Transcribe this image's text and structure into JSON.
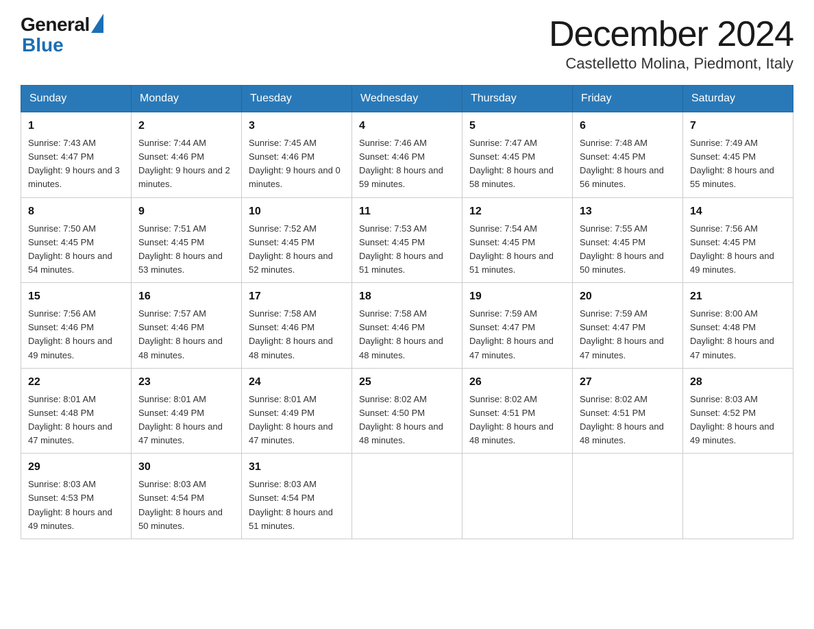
{
  "header": {
    "logo_general": "General",
    "logo_blue": "Blue",
    "month_title": "December 2024",
    "location": "Castelletto Molina, Piedmont, Italy"
  },
  "days_of_week": [
    "Sunday",
    "Monday",
    "Tuesday",
    "Wednesday",
    "Thursday",
    "Friday",
    "Saturday"
  ],
  "weeks": [
    [
      {
        "day": "1",
        "sunrise": "7:43 AM",
        "sunset": "4:47 PM",
        "daylight": "9 hours and 3 minutes."
      },
      {
        "day": "2",
        "sunrise": "7:44 AM",
        "sunset": "4:46 PM",
        "daylight": "9 hours and 2 minutes."
      },
      {
        "day": "3",
        "sunrise": "7:45 AM",
        "sunset": "4:46 PM",
        "daylight": "9 hours and 0 minutes."
      },
      {
        "day": "4",
        "sunrise": "7:46 AM",
        "sunset": "4:46 PM",
        "daylight": "8 hours and 59 minutes."
      },
      {
        "day": "5",
        "sunrise": "7:47 AM",
        "sunset": "4:45 PM",
        "daylight": "8 hours and 58 minutes."
      },
      {
        "day": "6",
        "sunrise": "7:48 AM",
        "sunset": "4:45 PM",
        "daylight": "8 hours and 56 minutes."
      },
      {
        "day": "7",
        "sunrise": "7:49 AM",
        "sunset": "4:45 PM",
        "daylight": "8 hours and 55 minutes."
      }
    ],
    [
      {
        "day": "8",
        "sunrise": "7:50 AM",
        "sunset": "4:45 PM",
        "daylight": "8 hours and 54 minutes."
      },
      {
        "day": "9",
        "sunrise": "7:51 AM",
        "sunset": "4:45 PM",
        "daylight": "8 hours and 53 minutes."
      },
      {
        "day": "10",
        "sunrise": "7:52 AM",
        "sunset": "4:45 PM",
        "daylight": "8 hours and 52 minutes."
      },
      {
        "day": "11",
        "sunrise": "7:53 AM",
        "sunset": "4:45 PM",
        "daylight": "8 hours and 51 minutes."
      },
      {
        "day": "12",
        "sunrise": "7:54 AM",
        "sunset": "4:45 PM",
        "daylight": "8 hours and 51 minutes."
      },
      {
        "day": "13",
        "sunrise": "7:55 AM",
        "sunset": "4:45 PM",
        "daylight": "8 hours and 50 minutes."
      },
      {
        "day": "14",
        "sunrise": "7:56 AM",
        "sunset": "4:45 PM",
        "daylight": "8 hours and 49 minutes."
      }
    ],
    [
      {
        "day": "15",
        "sunrise": "7:56 AM",
        "sunset": "4:46 PM",
        "daylight": "8 hours and 49 minutes."
      },
      {
        "day": "16",
        "sunrise": "7:57 AM",
        "sunset": "4:46 PM",
        "daylight": "8 hours and 48 minutes."
      },
      {
        "day": "17",
        "sunrise": "7:58 AM",
        "sunset": "4:46 PM",
        "daylight": "8 hours and 48 minutes."
      },
      {
        "day": "18",
        "sunrise": "7:58 AM",
        "sunset": "4:46 PM",
        "daylight": "8 hours and 48 minutes."
      },
      {
        "day": "19",
        "sunrise": "7:59 AM",
        "sunset": "4:47 PM",
        "daylight": "8 hours and 47 minutes."
      },
      {
        "day": "20",
        "sunrise": "7:59 AM",
        "sunset": "4:47 PM",
        "daylight": "8 hours and 47 minutes."
      },
      {
        "day": "21",
        "sunrise": "8:00 AM",
        "sunset": "4:48 PM",
        "daylight": "8 hours and 47 minutes."
      }
    ],
    [
      {
        "day": "22",
        "sunrise": "8:01 AM",
        "sunset": "4:48 PM",
        "daylight": "8 hours and 47 minutes."
      },
      {
        "day": "23",
        "sunrise": "8:01 AM",
        "sunset": "4:49 PM",
        "daylight": "8 hours and 47 minutes."
      },
      {
        "day": "24",
        "sunrise": "8:01 AM",
        "sunset": "4:49 PM",
        "daylight": "8 hours and 47 minutes."
      },
      {
        "day": "25",
        "sunrise": "8:02 AM",
        "sunset": "4:50 PM",
        "daylight": "8 hours and 48 minutes."
      },
      {
        "day": "26",
        "sunrise": "8:02 AM",
        "sunset": "4:51 PM",
        "daylight": "8 hours and 48 minutes."
      },
      {
        "day": "27",
        "sunrise": "8:02 AM",
        "sunset": "4:51 PM",
        "daylight": "8 hours and 48 minutes."
      },
      {
        "day": "28",
        "sunrise": "8:03 AM",
        "sunset": "4:52 PM",
        "daylight": "8 hours and 49 minutes."
      }
    ],
    [
      {
        "day": "29",
        "sunrise": "8:03 AM",
        "sunset": "4:53 PM",
        "daylight": "8 hours and 49 minutes."
      },
      {
        "day": "30",
        "sunrise": "8:03 AM",
        "sunset": "4:54 PM",
        "daylight": "8 hours and 50 minutes."
      },
      {
        "day": "31",
        "sunrise": "8:03 AM",
        "sunset": "4:54 PM",
        "daylight": "8 hours and 51 minutes."
      },
      null,
      null,
      null,
      null
    ]
  ]
}
